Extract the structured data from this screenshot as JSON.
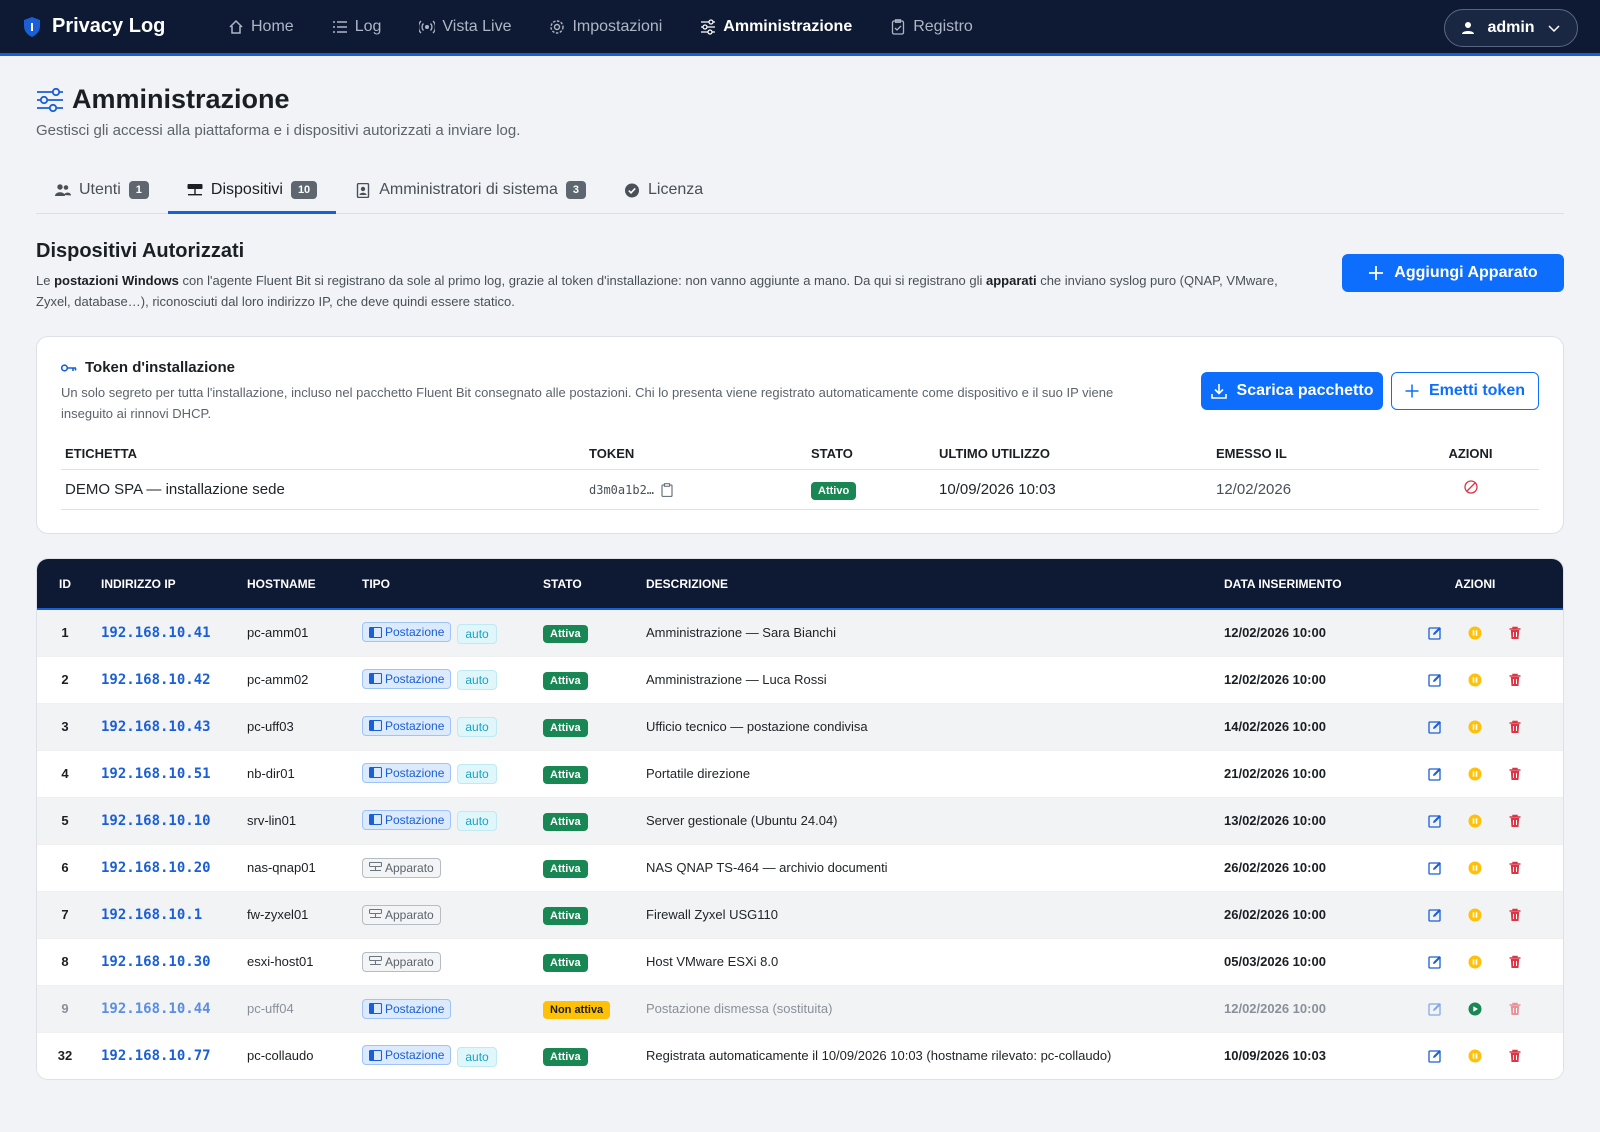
{
  "brand": "Privacy Log",
  "nav": [
    {
      "label": "Home",
      "icon": "home-icon"
    },
    {
      "label": "Log",
      "icon": "list-icon"
    },
    {
      "label": "Vista Live",
      "icon": "broadcast-icon"
    },
    {
      "label": "Impostazioni",
      "icon": "gear-icon"
    },
    {
      "label": "Amministrazione",
      "icon": "sliders-icon",
      "active": true
    },
    {
      "label": "Registro",
      "icon": "clipboard-check-icon"
    }
  ],
  "user": {
    "name": "admin"
  },
  "page": {
    "title": "Amministrazione",
    "subtitle": "Gestisci gli accessi alla piattaforma e i dispositivi autorizzati a inviare log."
  },
  "tabs": [
    {
      "label": "Utenti",
      "count": "1"
    },
    {
      "label": "Dispositivi",
      "count": "10",
      "active": true
    },
    {
      "label": "Amministratori di sistema",
      "count": "3"
    },
    {
      "label": "Licenza",
      "count": ""
    }
  ],
  "section": {
    "title": "Dispositivi Autorizzati",
    "desc_1": "Le ",
    "desc_b1": "postazioni Windows",
    "desc_2": " con l'agente Fluent Bit si registrano da sole al primo log, grazie al token d'installazione: non vanno aggiunte a mano. Da qui si registrano gli ",
    "desc_b2": "apparati",
    "desc_3": " che inviano syslog puro (QNAP, VMware, Zyxel, database…), riconosciuti dal loro indirizzo IP, che deve quindi essere statico.",
    "add_button": "Aggiungi Apparato"
  },
  "token_card": {
    "title": "Token d'installazione",
    "desc": "Un solo segreto per tutta l'installazione, incluso nel pacchetto Fluent Bit consegnato alle postazioni. Chi lo presenta viene registrato automaticamente come dispositivo e il suo IP viene inseguito ai rinnovi DHCP.",
    "download_button": "Scarica pacchetto",
    "issue_button": "Emetti token",
    "columns": [
      "ETICHETTA",
      "TOKEN",
      "STATO",
      "ULTIMO UTILIZZO",
      "EMESSO IL",
      "AZIONI"
    ],
    "row": {
      "label": "DEMO SPA — installazione sede",
      "token": "d3m0a1b2…",
      "status": "Attivo",
      "last_used": "10/09/2026 10:03",
      "issued": "12/02/2026"
    }
  },
  "devices": {
    "columns": [
      "ID",
      "INDIRIZZO IP",
      "HOSTNAME",
      "TIPO",
      "STATO",
      "DESCRIZIONE",
      "DATA INSERIMENTO",
      "AZIONI"
    ],
    "rows": [
      {
        "id": "1",
        "ip": "192.168.10.41",
        "host": "pc-amm01",
        "type": "Postazione",
        "auto": "auto",
        "status": "Attiva",
        "desc": "Amministrazione — Sara Bianchi",
        "date": "12/02/2026 10:00"
      },
      {
        "id": "2",
        "ip": "192.168.10.42",
        "host": "pc-amm02",
        "type": "Postazione",
        "auto": "auto",
        "status": "Attiva",
        "desc": "Amministrazione — Luca Rossi",
        "date": "12/02/2026 10:00"
      },
      {
        "id": "3",
        "ip": "192.168.10.43",
        "host": "pc-uff03",
        "type": "Postazione",
        "auto": "auto",
        "status": "Attiva",
        "desc": "Ufficio tecnico — postazione condivisa",
        "date": "14/02/2026 10:00"
      },
      {
        "id": "4",
        "ip": "192.168.10.51",
        "host": "nb-dir01",
        "type": "Postazione",
        "auto": "auto",
        "status": "Attiva",
        "desc": "Portatile direzione",
        "date": "21/02/2026 10:00"
      },
      {
        "id": "5",
        "ip": "192.168.10.10",
        "host": "srv-lin01",
        "type": "Postazione",
        "auto": "auto",
        "status": "Attiva",
        "desc": "Server gestionale (Ubuntu 24.04)",
        "date": "13/02/2026 10:00"
      },
      {
        "id": "6",
        "ip": "192.168.10.20",
        "host": "nas-qnap01",
        "type": "Apparato",
        "auto": "",
        "status": "Attiva",
        "desc": "NAS QNAP TS-464 — archivio documenti",
        "date": "26/02/2026 10:00"
      },
      {
        "id": "7",
        "ip": "192.168.10.1",
        "host": "fw-zyxel01",
        "type": "Apparato",
        "auto": "",
        "status": "Attiva",
        "desc": "Firewall Zyxel USG110",
        "date": "26/02/2026 10:00"
      },
      {
        "id": "8",
        "ip": "192.168.10.30",
        "host": "esxi-host01",
        "type": "Apparato",
        "auto": "",
        "status": "Attiva",
        "desc": "Host VMware ESXi 8.0",
        "date": "05/03/2026 10:00"
      },
      {
        "id": "9",
        "ip": "192.168.10.44",
        "host": "pc-uff04",
        "type": "Postazione",
        "auto": "",
        "status": "Non attiva",
        "desc": "Postazione dismessa (sostituita)",
        "date": "12/02/2026 10:00"
      },
      {
        "id": "32",
        "ip": "192.168.10.77",
        "host": "pc-collaudo",
        "type": "Postazione",
        "auto": "auto",
        "status": "Attiva",
        "desc": "Registrata automaticamente il 10/09/2026 10:03 (hostname rilevato: pc-collaudo)",
        "date": "10/09/2026 10:03"
      }
    ]
  },
  "colors": {
    "accent": "#0d6efd",
    "navbar": "#0e1a33",
    "success": "#198754",
    "warning": "#ffc107",
    "danger": "#dc3545"
  }
}
